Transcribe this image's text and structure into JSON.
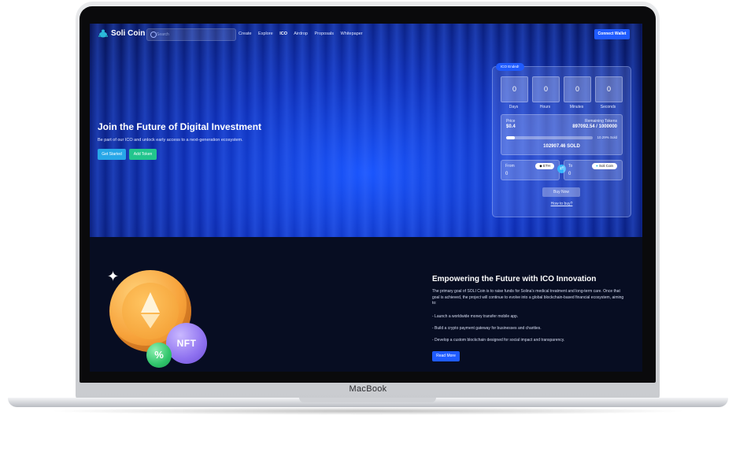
{
  "device": {
    "label": "MacBook"
  },
  "nav": {
    "brand": "Soli Coin",
    "search_placeholder": "Search",
    "links": [
      "Create",
      "Explore",
      "ICO",
      "Airdrop",
      "Proposals",
      "Whitepaper"
    ],
    "active_link": "ICO",
    "connect_label": "Connect Wallet"
  },
  "hero": {
    "title": "Join the Future of Digital Investment",
    "subtitle": "Be part of our ICO and unlock early access to a next-generation ecosystem.",
    "get_started_label": "Get Started",
    "add_token_label": "Add Token"
  },
  "ico": {
    "badge": "ICO Ended!",
    "countdown": [
      {
        "value": "0",
        "label": "Days"
      },
      {
        "value": "0",
        "label": "Hours"
      },
      {
        "value": "0",
        "label": "Minutes"
      },
      {
        "value": "0",
        "label": "Seconds"
      }
    ],
    "price_label": "Price",
    "price_value": "$0.4",
    "remaining_label": "Remaining Tokens",
    "remaining_value": "897092.54 / 1000000",
    "progress_pct": 10.29,
    "progress_text": "10.29% Sold",
    "sold_text": "102907.46 SOLD",
    "from_label": "From",
    "from_value": "0",
    "from_token": "ETH",
    "to_label": "To",
    "to_value": "0",
    "to_token": "Soli Coin",
    "buy_label": "Buy Now",
    "how_label": "How to buy?"
  },
  "section2": {
    "title": "Empowering the Future with ICO Innovation",
    "intro": "The primary goal of SOLI Coin is to raise funds for Solina's medical treatment and long-term care. Once that goal is achieved, the project will continue to evolve into a global blockchain-based financial ecosystem, aiming to:",
    "bullets": [
      "- Launch a worldwide money transfer mobile app.",
      "- Build a crypto payment gateway for businesses and charities.",
      "- Develop a custom blockchain designed for social impact and transparency."
    ],
    "read_more_label": "Read More",
    "nft_text": "NFT",
    "pct_text": "%"
  }
}
